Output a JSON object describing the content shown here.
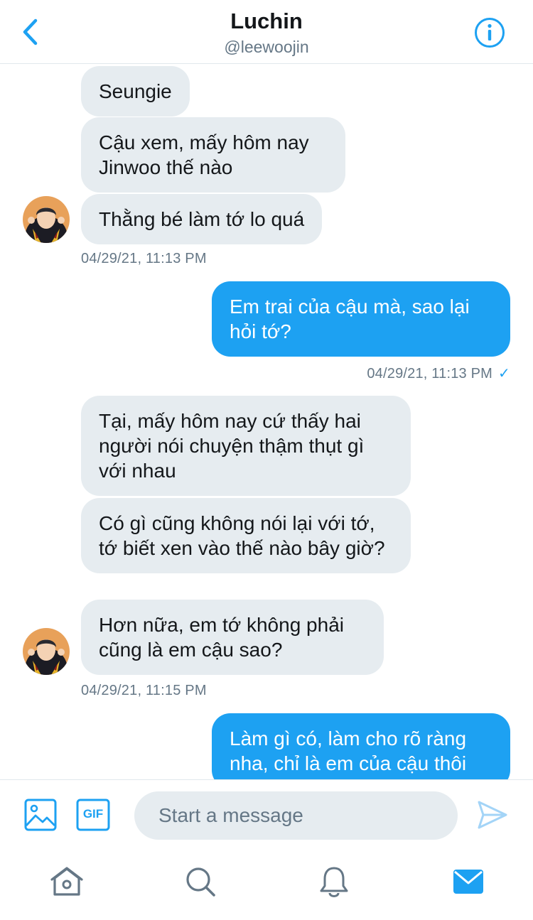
{
  "header": {
    "title": "Luchin",
    "handle": "@leewoojin",
    "back_icon": "chevron-left-icon",
    "info_icon": "info-circle-icon"
  },
  "colors": {
    "accent": "#1da1f2",
    "incoming_bubble": "#e6ecf0",
    "muted_text": "#657786"
  },
  "messages": [
    {
      "dir": "in",
      "text": "Seungie"
    },
    {
      "dir": "in",
      "text": "Cậu xem, mấy hôm nay Jinwoo thế nào"
    },
    {
      "dir": "in",
      "text": "Thằng bé làm tớ lo quá"
    },
    {
      "timestamp": "04/29/21, 11:13 PM"
    },
    {
      "dir": "out",
      "text": "Em trai của cậu mà, sao lại hỏi tớ?"
    },
    {
      "timestamp": "04/29/21, 11:13 PM",
      "read_mark": "✓"
    },
    {
      "dir": "in",
      "text": "Tại, mấy hôm nay cứ thấy hai người nói chuyện thậm thụt gì với nhau"
    },
    {
      "dir": "in",
      "text": "Có gì cũng không nói lại với tớ, tớ biết xen vào thế nào bây giờ?"
    },
    {
      "dir": "in",
      "text": "Hơn nữa, em tớ không phải cũng là em cậu sao?"
    },
    {
      "timestamp": "04/29/21, 11:15 PM"
    },
    {
      "dir": "out",
      "text": "Làm gì có, làm cho rõ ràng nha, chỉ là em của cậu thôi"
    }
  ],
  "compose": {
    "placeholder": "Start a message",
    "gif_label": "GIF",
    "image_icon": "image-icon",
    "send_icon": "send-icon"
  },
  "tabs": [
    {
      "name": "home",
      "icon": "home-icon"
    },
    {
      "name": "search",
      "icon": "search-icon"
    },
    {
      "name": "notifications",
      "icon": "bell-icon"
    },
    {
      "name": "messages",
      "icon": "mail-icon",
      "active": true
    }
  ]
}
